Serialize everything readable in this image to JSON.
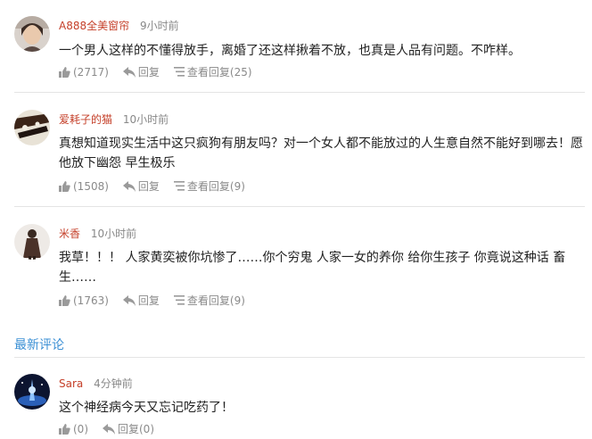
{
  "comments": [
    {
      "user": "A888全美窗帘",
      "time": "9小时前",
      "text": "一个男人这样的不懂得放手，离婚了还这样揪着不放，也真是人品有问题。不咋样。",
      "likes": "(2717)",
      "reply_label": "回复",
      "view_replies": "查看回复(25)"
    },
    {
      "user": "爱耗子的猫",
      "time": "10小时前",
      "text": "真想知道现实生活中这只疯狗有朋友吗？对一个女人都不能放过的人生意自然不能好到哪去！愿他放下幽怨 早生极乐",
      "likes": "(1508)",
      "reply_label": "回复",
      "view_replies": "查看回复(9)"
    },
    {
      "user": "米香",
      "time": "10小时前",
      "text": "我草！！！ 人家黄奕被你坑惨了……你个穷鬼 人家一女的养你 给你生孩子 你竟说这种话 畜生……",
      "likes": "(1763)",
      "reply_label": "回复",
      "view_replies": "查看回复(9)"
    }
  ],
  "latest_section": {
    "title": "最新评论",
    "comments": [
      {
        "user": "Sara",
        "time": "4分钟前",
        "text": "这个神经病今天又忘记吃药了！",
        "likes": "(0)",
        "reply_label": "回复(0)"
      }
    ]
  },
  "colors": {
    "username": "#c5402a",
    "section_title": "#3a8fd4",
    "meta_gray": "#888888"
  },
  "icons": [
    "thumbs-up-icon",
    "reply-arrow-icon",
    "list-icon"
  ]
}
